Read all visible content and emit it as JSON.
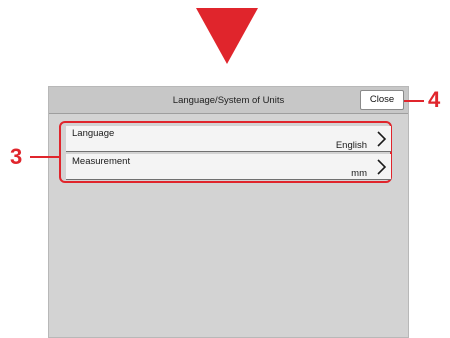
{
  "panel": {
    "title": "Language/System of Units",
    "close_label": "Close"
  },
  "settings": [
    {
      "label": "Language",
      "value": "English"
    },
    {
      "label": "Measurement",
      "value": "mm"
    }
  ],
  "callouts": {
    "list": "3",
    "close": "4"
  },
  "colors": {
    "accent": "#e0252c",
    "panel_bg": "#d3d3d3",
    "header_bg": "#c7c7c7",
    "item_bg": "#f4f4f4"
  },
  "icons": {
    "indicator": "down-triangle-icon",
    "item_action": "chevron-right-icon"
  }
}
